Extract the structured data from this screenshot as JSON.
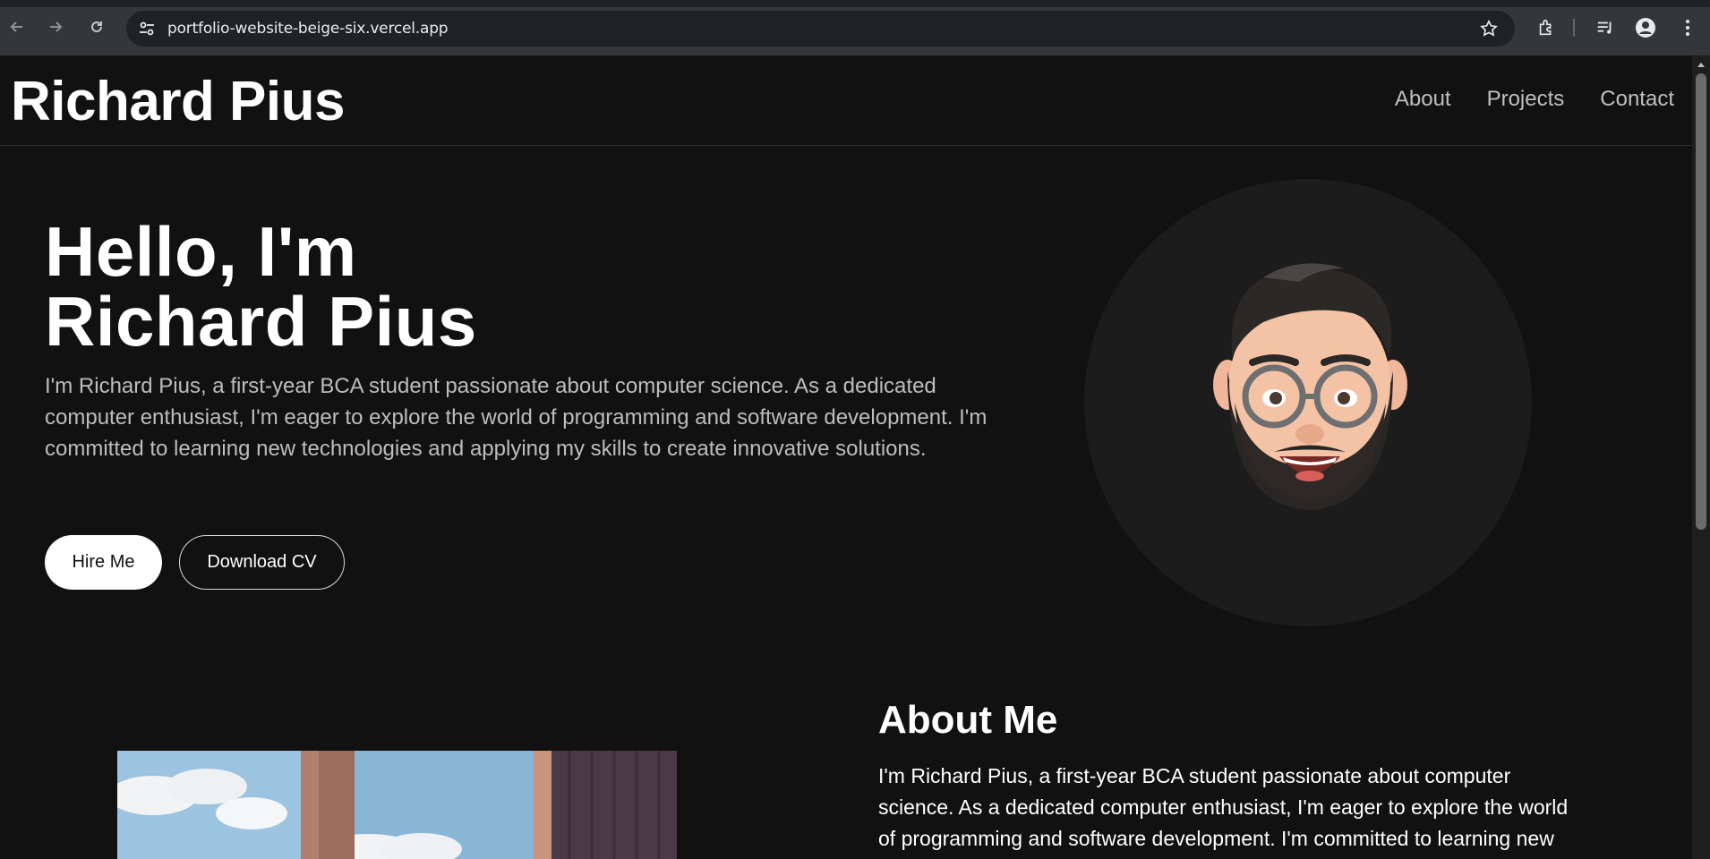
{
  "browser": {
    "url": "portfolio-website-beige-six.vercel.app"
  },
  "header": {
    "logo": "Richard Pius",
    "nav": [
      "About",
      "Projects",
      "Contact"
    ]
  },
  "hero": {
    "title_line1": "Hello, I'm",
    "title_line2": "Richard Pius",
    "description": "I'm Richard Pius, a first-year BCA student passionate about computer science. As a dedicated computer enthusiast, I'm eager to explore the world of programming and software development. I'm committed to learning new technologies and applying my skills to create innovative solutions.",
    "hire_label": "Hire Me",
    "cv_label": "Download CV"
  },
  "about": {
    "title": "About Me",
    "text": "I'm Richard Pius, a first-year BCA student passionate about computer science. As a dedicated computer enthusiast, I'm eager to explore the world of programming and software development. I'm committed to learning new"
  },
  "colors": {
    "page_bg": "#111111",
    "chrome_bg": "#35363a",
    "accent": "#ffffff"
  }
}
